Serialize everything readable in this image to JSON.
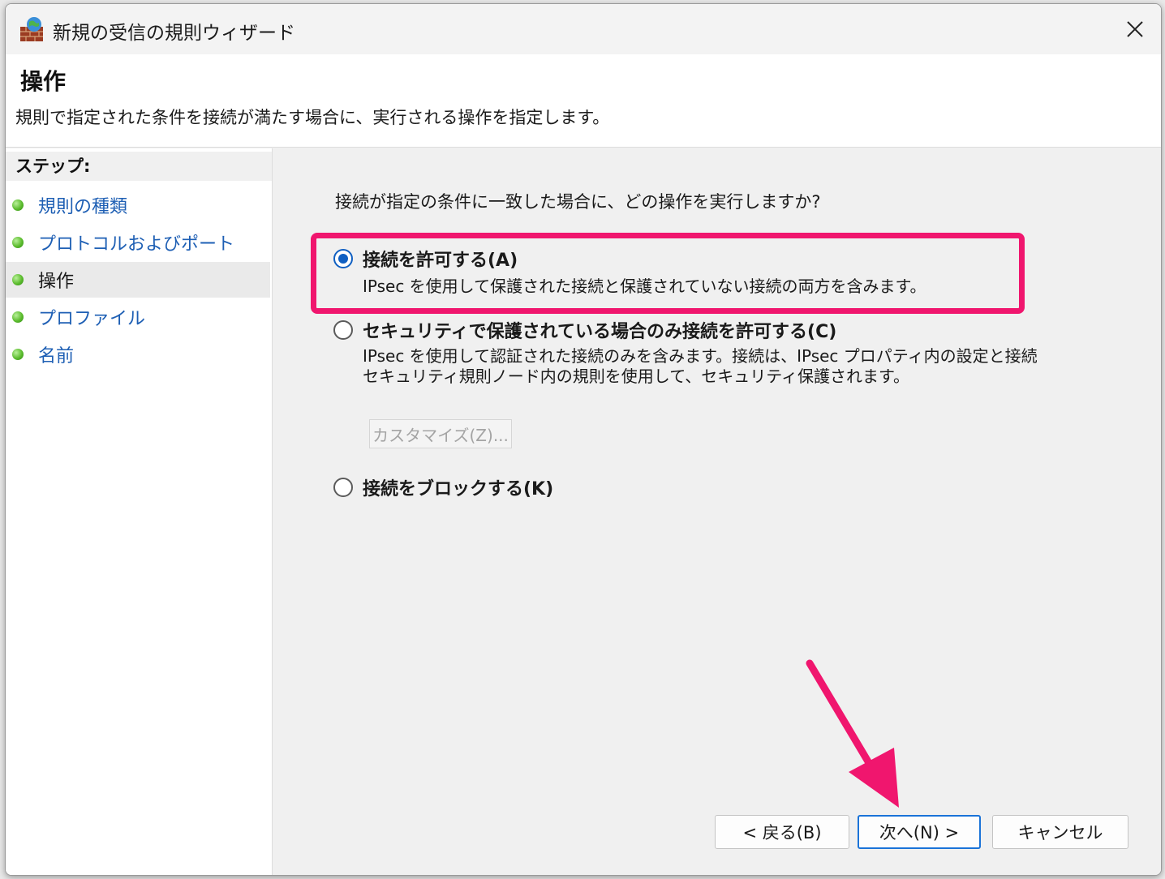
{
  "window": {
    "title": "新規の受信の規則ウィザード"
  },
  "header": {
    "title": "操作",
    "description": "規則で指定された条件を接続が満たす場合に、実行される操作を指定します。"
  },
  "sidebar": {
    "steps_label": "ステップ:",
    "items": [
      {
        "label": "規則の種類",
        "active": false
      },
      {
        "label": "プロトコルおよびポート",
        "active": false
      },
      {
        "label": "操作",
        "active": true
      },
      {
        "label": "プロファイル",
        "active": false
      },
      {
        "label": "名前",
        "active": false
      }
    ]
  },
  "main": {
    "question": "接続が指定の条件に一致した場合に、どの操作を実行しますか?",
    "options": [
      {
        "label": "接続を許可する(A)",
        "description": "IPsec を使用して保護された接続と保護されていない接続の両方を含みます。",
        "checked": true
      },
      {
        "label": "セキュリティで保護されている場合のみ接続を許可する(C)",
        "description_line1": "IPsec を使用して認証された接続のみを含みます。接続は、IPsec プロパティ内の設定と接続",
        "description_line2": "セキュリティ規則ノード内の規則を使用して、セキュリティ保護されます。",
        "checked": false
      },
      {
        "label": "接続をブロックする(K)",
        "checked": false
      }
    ],
    "customize_label": "カスタマイズ(Z)..."
  },
  "buttons": {
    "back": "< 戻る(B)",
    "next": "次へ(N) >",
    "cancel": "キャンセル"
  },
  "colors": {
    "highlight": "#f0166e",
    "link": "#1e5fb4",
    "radio_selected": "#0f5fc2",
    "primary_border": "#1a73d8"
  }
}
